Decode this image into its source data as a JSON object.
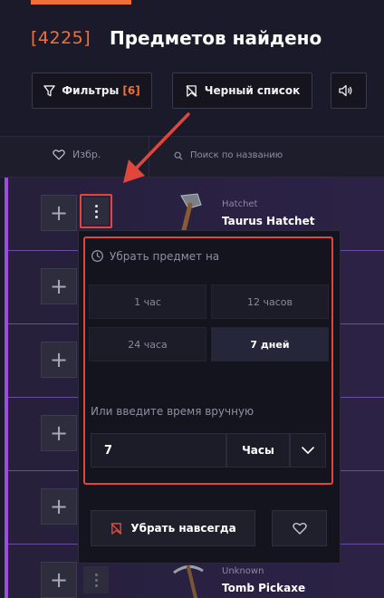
{
  "header": {
    "count": "[4225]",
    "title": "Предметов найдено"
  },
  "toolbar": {
    "filters_label": "Фильтры",
    "filters_count": "[6]",
    "blacklist_label": "Черный список"
  },
  "list_header": {
    "favorites_label": "Избр.",
    "search_placeholder": "Поиск по названию"
  },
  "items": [
    {
      "type": "Hatchet",
      "name": "Taurus Hatchet"
    },
    {
      "type": "Unknown",
      "name": "Tomb Pickaxe"
    }
  ],
  "remove_panel": {
    "title": "Убрать предмет на",
    "options": [
      "1 час",
      "12 часов",
      "24 часа",
      "7 дней"
    ],
    "selected_option": "7 дней",
    "manual_label": "Или введите время вручную",
    "manual_value": "7",
    "unit_value": "Часы",
    "forever_label": "Убрать навсегда"
  },
  "colors": {
    "accent_orange": "#f0703a",
    "highlight_red": "#e0463c",
    "row_border_purple": "#6c4ca3",
    "left_bar_purple": "#9b4fdc"
  }
}
